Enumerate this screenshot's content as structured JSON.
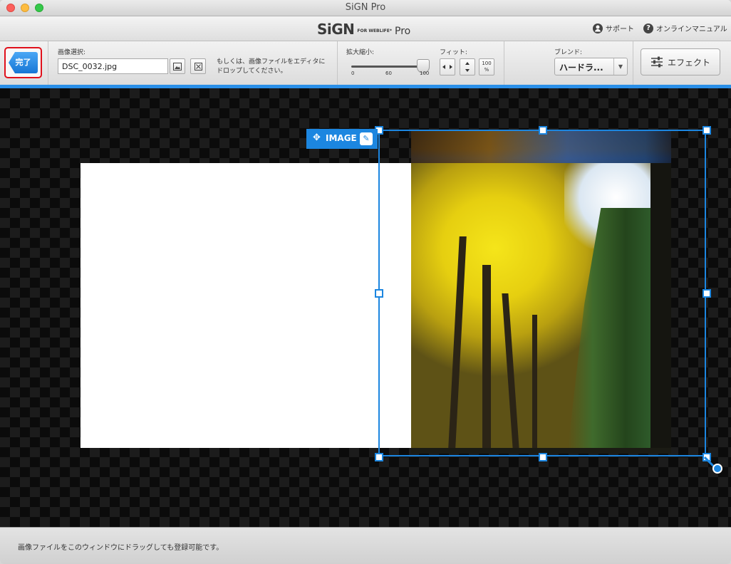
{
  "window": {
    "title": "SiGN Pro"
  },
  "brand": {
    "logo": "SiGN",
    "sub": "FOR WEBLIFE*",
    "pro": "Pro"
  },
  "links": {
    "support": "サポート",
    "manual": "オンラインマニュアル"
  },
  "toolbar": {
    "done_label": "完了",
    "image_select_label": "画像選択:",
    "file_value": "DSC_0032.jpg",
    "hint_line1": "もしくは、画像ファイルをエディタに",
    "hint_line2": "ドロップしてください。",
    "zoom_label": "拡大縮小:",
    "zoom_ticks": [
      "0",
      "60",
      "100"
    ],
    "zoom_value": 100,
    "fit_label": "フィット:",
    "fit_100": "100",
    "fit_percent": "%",
    "blend_label": "ブレンド:",
    "blend_value": "ハードラ...",
    "effect_label": "エフェクト"
  },
  "selection": {
    "tag_label": "IMAGE"
  },
  "status": {
    "text": "画像ファイルをこのウィンドウにドラッグしても登録可能です。"
  },
  "icons": [
    "support-icon",
    "help-icon",
    "image-icon",
    "clear-icon",
    "fit-horizontal-icon",
    "fit-vertical-icon",
    "sliders-icon",
    "move-icon",
    "pencil-icon"
  ],
  "colors": {
    "accent": "#1c86e0",
    "done_highlight": "#e0101b"
  }
}
